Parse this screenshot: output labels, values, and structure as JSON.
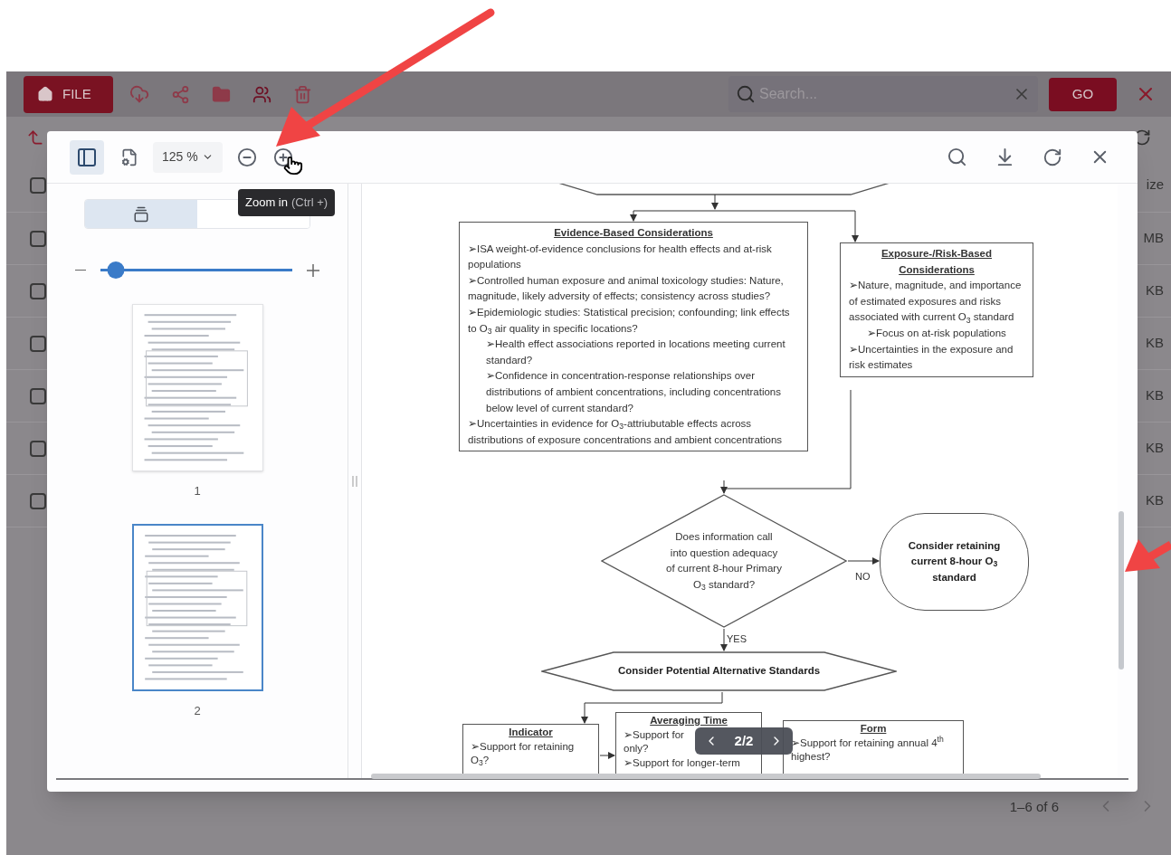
{
  "app": {
    "file_button": "FILE",
    "search": {
      "placeholder": "Search..."
    },
    "go_button": "GO",
    "size_header": "ize",
    "header_checked": false,
    "rows": [
      {
        "checked": false,
        "size": "MB"
      },
      {
        "checked": false,
        "size": "KB"
      },
      {
        "checked": false,
        "size": "KB"
      },
      {
        "checked": false,
        "size": "KB"
      },
      {
        "checked": false,
        "size": "KB"
      },
      {
        "checked": false,
        "size": "KB"
      }
    ],
    "pagination": "1–6 of 6"
  },
  "viewer": {
    "sidebar_toggle": {
      "selected": true
    },
    "zoom": "125 %",
    "tooltip": {
      "label": "Zoom in",
      "shortcut": "(Ctrl +)"
    },
    "sidebar_tabs": [
      {
        "kind": "thumbnails",
        "selected": true
      },
      {
        "kind": "outline",
        "selected": false
      }
    ],
    "thumbnail_size": {
      "level": 0.08
    },
    "pages": [
      {
        "label": "1",
        "selected": false
      },
      {
        "label": "2",
        "selected": true
      }
    ],
    "page_indicator": "2/2"
  },
  "document": {
    "evidence_box": {
      "title": "Evidence-Based Considerations",
      "items": [
        {
          "text": "➢ISA weight-of-evidence conclusions for health effects and at-risk populations"
        },
        {
          "text": "➢Controlled human exposure and animal toxicology studies: Nature, magnitude, likely adversity of effects; consistency across studies?"
        },
        {
          "text": "➢Epidemiologic studies: Statistical precision; confounding; link effects to O$_{3}$ air quality in specific locations?",
          "children": [
            {
              "text": "➢Health effect associations reported in locations meeting current standard?"
            },
            {
              "text": "➢Confidence in concentration-response  relationships over distributions of ambient concentrations, including concentrations below level of current standard?"
            }
          ]
        },
        {
          "text": "➢Uncertainties in evidence for O$_{3}$-attriubutable effects across distributions of exposure concentrations and ambient concentrations"
        }
      ]
    },
    "exposure_box": {
      "title": "Exposure-/Risk-Based Considerations",
      "items": [
        {
          "text": "➢Nature, magnitude, and importance of estimated exposures and risks associated with current O$_{3}$ standard",
          "children": [
            {
              "text": "➢Focus on at-risk populations"
            }
          ]
        },
        {
          "text": "➢Uncertainties in the exposure and risk estimates"
        }
      ]
    },
    "decision": "Does information call into question adequacy of current 8-hour Primary O$_{3}$ standard?",
    "no_label": "NO",
    "yes_label": "YES",
    "terminal": "Consider retaining current 8-hour O$_{3}$ standard",
    "alternatives": "Consider Potential Alternative Standards",
    "criteria": [
      {
        "title": "Indicator",
        "lines": [
          "➢Support for retaining O$_{3}$?"
        ]
      },
      {
        "title": "Averaging Time",
        "lines": [
          "➢Support for",
          "only?",
          "➢Support for longer-term"
        ]
      },
      {
        "title": "Form",
        "lines": [
          "➢Support for retaining annual 4$^{th}$ highest?"
        ]
      }
    ]
  }
}
